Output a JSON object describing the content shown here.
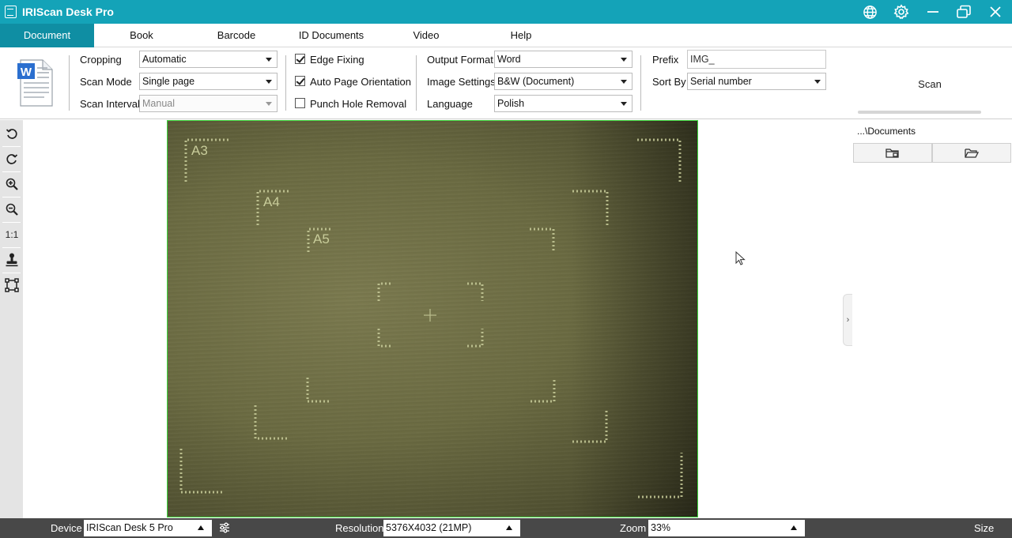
{
  "window": {
    "title": "IRIScan Desk Pro"
  },
  "titlebar_icons": [
    "globe-icon",
    "gear-icon",
    "minimize-icon",
    "restore-icon",
    "close-icon"
  ],
  "menu": {
    "tabs": [
      "Document",
      "Book",
      "Barcode",
      "ID Documents",
      "Video",
      "Help"
    ],
    "active": "Document"
  },
  "ribbon": {
    "cropping_label": "Cropping",
    "cropping_value": "Automatic",
    "scan_mode_label": "Scan Mode",
    "scan_mode_value": "Single page",
    "scan_interval_label": "Scan Interval",
    "scan_interval_value": "Manual",
    "edge_fixing_label": "Edge Fixing",
    "edge_fixing_checked": true,
    "auto_orientation_label": "Auto Page Orientation",
    "auto_orientation_checked": true,
    "punch_hole_label": "Punch Hole Removal",
    "punch_hole_checked": false,
    "output_format_label": "Output Format",
    "output_format_value": "Word",
    "image_settings_label": "Image Settings",
    "image_settings_value": "B&W (Document)",
    "language_label": "Language",
    "language_value": "Polish",
    "prefix_label": "Prefix",
    "prefix_value": "IMG_",
    "sort_by_label": "Sort By",
    "sort_by_value": "Serial number",
    "scan_label": "Scan"
  },
  "left_tools": [
    "rotate-left-icon",
    "rotate-right-icon",
    "zoom-in-icon",
    "zoom-out-icon",
    "actual-size",
    "stamp-icon",
    "crop-frame-icon"
  ],
  "left_tools_actual_size_text": "1:1",
  "preview": {
    "marks": [
      "A3",
      "A4",
      "A5"
    ]
  },
  "right_panel": {
    "path": "...\\Documents"
  },
  "statusbar": {
    "device_label": "Device",
    "device_value": "IRIScan Desk 5 Pro",
    "resolution_label": "Resolution",
    "resolution_value": "5376X4032 (21MP)",
    "zoom_label": "Zoom",
    "zoom_value": "33%",
    "size_label": "Size"
  },
  "colors": {
    "titlebar": "#14a3b8",
    "active_tab": "#0f8ea3",
    "preview_border": "#3ed83e",
    "statusbar": "#484848"
  }
}
